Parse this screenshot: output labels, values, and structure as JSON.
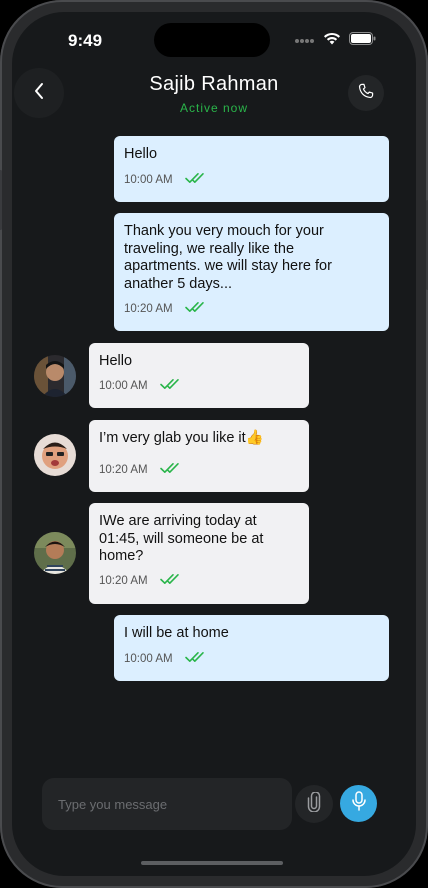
{
  "status_bar": {
    "time": "9:49"
  },
  "header": {
    "contact_name": "Sajib Rahman",
    "contact_status": "Active now"
  },
  "colors": {
    "accent": "#2ab54a",
    "mic": "#36a9e1",
    "outgoing_bubble": "#dcefff",
    "incoming_bubble": "#f1f1f3",
    "background": "#17191b"
  },
  "messages": [
    {
      "direction": "out",
      "lines": [
        "Hello"
      ],
      "time": "10:00 AM",
      "read": true
    },
    {
      "direction": "out",
      "lines": [
        "Thank you very mouch for your",
        "traveling, we really like the",
        "apartments. we will stay here for",
        "anather 5 days..."
      ],
      "time": "10:20 AM",
      "read": true
    },
    {
      "direction": "in",
      "lines": [
        "Hello"
      ],
      "time": "10:00 AM",
      "read": true,
      "avatar": "avatar-1"
    },
    {
      "direction": "in",
      "lines": [
        "I’m very glab you like it👍"
      ],
      "time": "10:20 AM",
      "read": true,
      "avatar": "avatar-2"
    },
    {
      "direction": "in",
      "lines": [
        "IWe are arriving today at",
        "01:45, will someone be at",
        "home?"
      ],
      "time": "10:20 AM",
      "read": true,
      "avatar": "avatar-3"
    },
    {
      "direction": "out",
      "lines": [
        "I will be at home"
      ],
      "time": "10:00 AM",
      "read": true
    }
  ],
  "composer": {
    "placeholder": "Type you message"
  },
  "icons": {
    "back": "chevron-left-icon",
    "call": "phone-icon",
    "attach": "paperclip-icon",
    "mic": "microphone-icon",
    "read": "double-check-icon"
  }
}
